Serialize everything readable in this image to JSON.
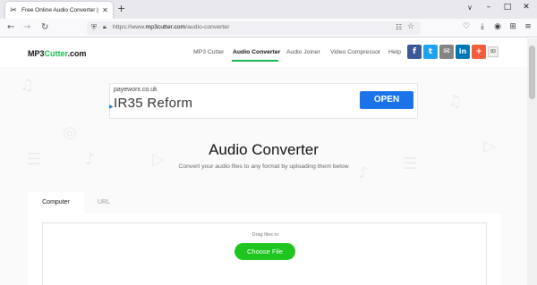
{
  "browser": {
    "tab_title": "Free Online Audio Converter |  ",
    "tab_favicon": "✂",
    "tab_close": "✕",
    "new_tab": "+",
    "tabs_menu": "∨",
    "window_controls": {
      "minimize": "–",
      "maximize": "□",
      "close": "✕"
    },
    "nav": {
      "back": "←",
      "forward": "→",
      "reload": "↻"
    },
    "url_prefix": "https://www.",
    "url_domain": "mp3cutter.com",
    "url_path": "/audio-converter",
    "icons": [
      "shield-icon",
      "lock-icon",
      "reader-view-icon",
      "bookmark-star-icon",
      "pocket-icon",
      "download-icon",
      "account-icon",
      "extensions-icon",
      "menu-icon"
    ]
  },
  "site": {
    "logo_prefix": "MP3",
    "logo_accent": "Cutter",
    "logo_suffix": ".com",
    "brand_color": "#1db954",
    "menu": [
      "MP3 Cutter",
      "Audio Converter",
      "Audio Joiner",
      "Video Compressor",
      "Help"
    ],
    "active_menu": "Audio Converter",
    "social": [
      {
        "name": "facebook",
        "label": "f",
        "color": "#3b5998"
      },
      {
        "name": "twitter",
        "label": "t",
        "color": "#1da1f2"
      },
      {
        "name": "email",
        "label": "✉",
        "color": "#848484"
      },
      {
        "name": "linkedin",
        "label": "in",
        "color": "#0077b5"
      },
      {
        "name": "more",
        "label": "+",
        "color": "#f05e3f"
      }
    ],
    "share_count": "83"
  },
  "ad": {
    "domain": "payeworx.co.uk",
    "headline": "IR35 Reform",
    "cta": "OPEN",
    "cta_color": "#1a73e8",
    "adchoices": "▶"
  },
  "main": {
    "title": "Audio Converter",
    "subtitle": "Convert your audio files to any format by uploading them below",
    "tabs": [
      "Computer",
      "URL"
    ],
    "drag_text": "Drag files or",
    "choose_button": "Choose File",
    "button_color": "#1ec51e"
  }
}
